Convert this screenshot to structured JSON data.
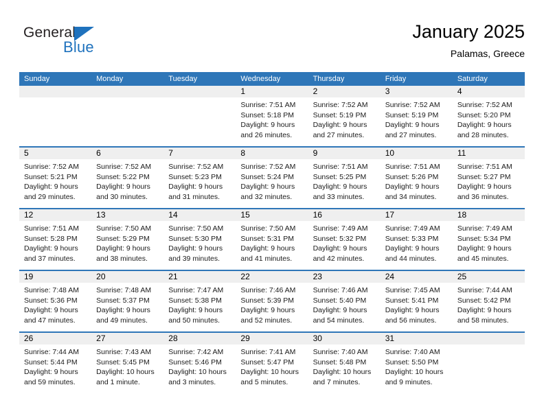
{
  "brand": {
    "name_top": "General",
    "name_bottom": "Blue",
    "accent_color": "#1f72bd"
  },
  "header": {
    "title": "January 2025",
    "subtitle": "Palamas, Greece"
  },
  "calendar": {
    "header_color": "#2e76b8",
    "day_band_color": "#efefef",
    "weekdays": [
      "Sunday",
      "Monday",
      "Tuesday",
      "Wednesday",
      "Thursday",
      "Friday",
      "Saturday"
    ],
    "weeks": [
      [
        {
          "day": "",
          "lines": []
        },
        {
          "day": "",
          "lines": []
        },
        {
          "day": "",
          "lines": []
        },
        {
          "day": "1",
          "lines": [
            "Sunrise: 7:51 AM",
            "Sunset: 5:18 PM",
            "Daylight: 9 hours",
            "and 26 minutes."
          ]
        },
        {
          "day": "2",
          "lines": [
            "Sunrise: 7:52 AM",
            "Sunset: 5:19 PM",
            "Daylight: 9 hours",
            "and 27 minutes."
          ]
        },
        {
          "day": "3",
          "lines": [
            "Sunrise: 7:52 AM",
            "Sunset: 5:19 PM",
            "Daylight: 9 hours",
            "and 27 minutes."
          ]
        },
        {
          "day": "4",
          "lines": [
            "Sunrise: 7:52 AM",
            "Sunset: 5:20 PM",
            "Daylight: 9 hours",
            "and 28 minutes."
          ]
        }
      ],
      [
        {
          "day": "5",
          "lines": [
            "Sunrise: 7:52 AM",
            "Sunset: 5:21 PM",
            "Daylight: 9 hours",
            "and 29 minutes."
          ]
        },
        {
          "day": "6",
          "lines": [
            "Sunrise: 7:52 AM",
            "Sunset: 5:22 PM",
            "Daylight: 9 hours",
            "and 30 minutes."
          ]
        },
        {
          "day": "7",
          "lines": [
            "Sunrise: 7:52 AM",
            "Sunset: 5:23 PM",
            "Daylight: 9 hours",
            "and 31 minutes."
          ]
        },
        {
          "day": "8",
          "lines": [
            "Sunrise: 7:52 AM",
            "Sunset: 5:24 PM",
            "Daylight: 9 hours",
            "and 32 minutes."
          ]
        },
        {
          "day": "9",
          "lines": [
            "Sunrise: 7:51 AM",
            "Sunset: 5:25 PM",
            "Daylight: 9 hours",
            "and 33 minutes."
          ]
        },
        {
          "day": "10",
          "lines": [
            "Sunrise: 7:51 AM",
            "Sunset: 5:26 PM",
            "Daylight: 9 hours",
            "and 34 minutes."
          ]
        },
        {
          "day": "11",
          "lines": [
            "Sunrise: 7:51 AM",
            "Sunset: 5:27 PM",
            "Daylight: 9 hours",
            "and 36 minutes."
          ]
        }
      ],
      [
        {
          "day": "12",
          "lines": [
            "Sunrise: 7:51 AM",
            "Sunset: 5:28 PM",
            "Daylight: 9 hours",
            "and 37 minutes."
          ]
        },
        {
          "day": "13",
          "lines": [
            "Sunrise: 7:50 AM",
            "Sunset: 5:29 PM",
            "Daylight: 9 hours",
            "and 38 minutes."
          ]
        },
        {
          "day": "14",
          "lines": [
            "Sunrise: 7:50 AM",
            "Sunset: 5:30 PM",
            "Daylight: 9 hours",
            "and 39 minutes."
          ]
        },
        {
          "day": "15",
          "lines": [
            "Sunrise: 7:50 AM",
            "Sunset: 5:31 PM",
            "Daylight: 9 hours",
            "and 41 minutes."
          ]
        },
        {
          "day": "16",
          "lines": [
            "Sunrise: 7:49 AM",
            "Sunset: 5:32 PM",
            "Daylight: 9 hours",
            "and 42 minutes."
          ]
        },
        {
          "day": "17",
          "lines": [
            "Sunrise: 7:49 AM",
            "Sunset: 5:33 PM",
            "Daylight: 9 hours",
            "and 44 minutes."
          ]
        },
        {
          "day": "18",
          "lines": [
            "Sunrise: 7:49 AM",
            "Sunset: 5:34 PM",
            "Daylight: 9 hours",
            "and 45 minutes."
          ]
        }
      ],
      [
        {
          "day": "19",
          "lines": [
            "Sunrise: 7:48 AM",
            "Sunset: 5:36 PM",
            "Daylight: 9 hours",
            "and 47 minutes."
          ]
        },
        {
          "day": "20",
          "lines": [
            "Sunrise: 7:48 AM",
            "Sunset: 5:37 PM",
            "Daylight: 9 hours",
            "and 49 minutes."
          ]
        },
        {
          "day": "21",
          "lines": [
            "Sunrise: 7:47 AM",
            "Sunset: 5:38 PM",
            "Daylight: 9 hours",
            "and 50 minutes."
          ]
        },
        {
          "day": "22",
          "lines": [
            "Sunrise: 7:46 AM",
            "Sunset: 5:39 PM",
            "Daylight: 9 hours",
            "and 52 minutes."
          ]
        },
        {
          "day": "23",
          "lines": [
            "Sunrise: 7:46 AM",
            "Sunset: 5:40 PM",
            "Daylight: 9 hours",
            "and 54 minutes."
          ]
        },
        {
          "day": "24",
          "lines": [
            "Sunrise: 7:45 AM",
            "Sunset: 5:41 PM",
            "Daylight: 9 hours",
            "and 56 minutes."
          ]
        },
        {
          "day": "25",
          "lines": [
            "Sunrise: 7:44 AM",
            "Sunset: 5:42 PM",
            "Daylight: 9 hours",
            "and 58 minutes."
          ]
        }
      ],
      [
        {
          "day": "26",
          "lines": [
            "Sunrise: 7:44 AM",
            "Sunset: 5:44 PM",
            "Daylight: 9 hours",
            "and 59 minutes."
          ]
        },
        {
          "day": "27",
          "lines": [
            "Sunrise: 7:43 AM",
            "Sunset: 5:45 PM",
            "Daylight: 10 hours",
            "and 1 minute."
          ]
        },
        {
          "day": "28",
          "lines": [
            "Sunrise: 7:42 AM",
            "Sunset: 5:46 PM",
            "Daylight: 10 hours",
            "and 3 minutes."
          ]
        },
        {
          "day": "29",
          "lines": [
            "Sunrise: 7:41 AM",
            "Sunset: 5:47 PM",
            "Daylight: 10 hours",
            "and 5 minutes."
          ]
        },
        {
          "day": "30",
          "lines": [
            "Sunrise: 7:40 AM",
            "Sunset: 5:48 PM",
            "Daylight: 10 hours",
            "and 7 minutes."
          ]
        },
        {
          "day": "31",
          "lines": [
            "Sunrise: 7:40 AM",
            "Sunset: 5:50 PM",
            "Daylight: 10 hours",
            "and 9 minutes."
          ]
        },
        {
          "day": "",
          "lines": []
        }
      ]
    ]
  }
}
